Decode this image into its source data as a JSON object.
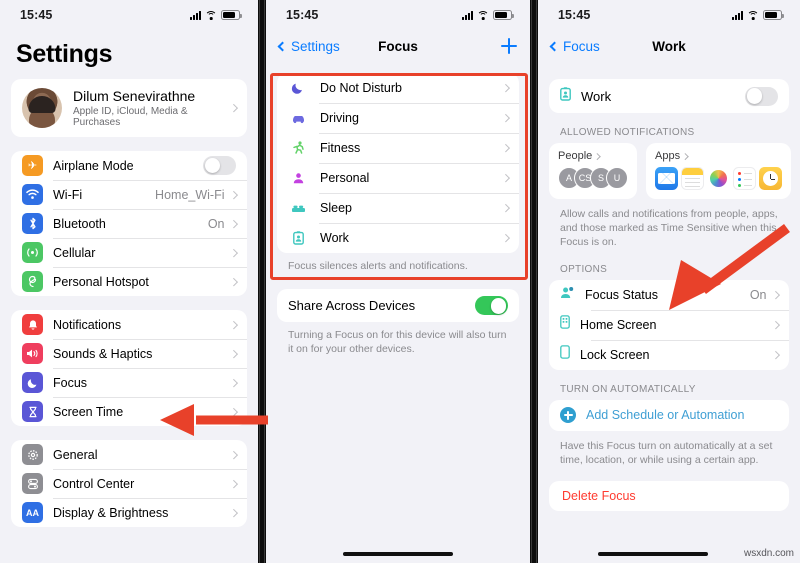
{
  "statusbar": {
    "time": "15:45"
  },
  "panel1": {
    "title": "Settings",
    "profile": {
      "name": "Dilum Senevirathne",
      "subtitle": "Apple ID, iCloud, Media & Purchases"
    },
    "group_connectivity": [
      {
        "label": "Airplane Mode",
        "icon": "airplane-icon",
        "color": "#f59a23",
        "control": "toggle",
        "value": "off"
      },
      {
        "label": "Wi-Fi",
        "icon": "wifi-icon",
        "color": "#2f6fe4",
        "value": "Home_Wi-Fi",
        "control": "chevron"
      },
      {
        "label": "Bluetooth",
        "icon": "bluetooth-icon",
        "color": "#2f6fe4",
        "value": "On",
        "control": "chevron"
      },
      {
        "label": "Cellular",
        "icon": "cellular-icon",
        "color": "#4cc764",
        "value": "",
        "control": "chevron"
      },
      {
        "label": "Personal Hotspot",
        "icon": "hotspot-icon",
        "color": "#4cc764",
        "value": "",
        "control": "chevron"
      }
    ],
    "group_alerts": [
      {
        "label": "Notifications",
        "icon": "bell-icon",
        "color": "#f03e3e"
      },
      {
        "label": "Sounds & Haptics",
        "icon": "speaker-icon",
        "color": "#ef3e5e"
      },
      {
        "label": "Focus",
        "icon": "moon-icon",
        "color": "#5a56d6"
      },
      {
        "label": "Screen Time",
        "icon": "hourglass-icon",
        "color": "#5a56d6"
      }
    ],
    "group_system": [
      {
        "label": "General",
        "icon": "gear-icon",
        "color": "#8e8e93"
      },
      {
        "label": "Control Center",
        "icon": "sliders-icon",
        "color": "#8e8e93"
      },
      {
        "label": "Display & Brightness",
        "icon": "display-icon",
        "color": "#2f6fe4"
      }
    ]
  },
  "panel2": {
    "nav": {
      "back": "Settings",
      "title": "Focus",
      "add": "add-icon"
    },
    "focus_items": [
      {
        "label": "Do Not Disturb",
        "icon": "moon-icon",
        "color": "#5a56d6"
      },
      {
        "label": "Driving",
        "icon": "car-icon",
        "color": "#6d6ae0"
      },
      {
        "label": "Fitness",
        "icon": "running-icon",
        "color": "#63d26a"
      },
      {
        "label": "Personal",
        "icon": "person-icon",
        "color": "#c341e0"
      },
      {
        "label": "Sleep",
        "icon": "bed-icon",
        "color": "#3fc7bf"
      },
      {
        "label": "Work",
        "icon": "badge-icon",
        "color": "#3fc7bf"
      }
    ],
    "focus_footnote": "Focus silences alerts and notifications.",
    "share": {
      "label": "Share Across Devices",
      "value": "on"
    },
    "share_footnote": "Turning a Focus on for this device will also turn it on for your other devices."
  },
  "panel3": {
    "nav": {
      "back": "Focus",
      "title": "Work"
    },
    "header_row": {
      "label": "Work",
      "icon": "badge-icon",
      "value": "off"
    },
    "allowed_header": "ALLOWED NOTIFICATIONS",
    "people": {
      "label": "People",
      "avatars": [
        "A",
        "CS",
        "S",
        "U"
      ]
    },
    "apps": {
      "label": "Apps",
      "icons": [
        "mail-icon",
        "notes-icon",
        "photos-icon",
        "reminders-icon",
        "clock-icon"
      ]
    },
    "allowed_footnote": "Allow calls and notifications from people, apps, and those marked as Time Sensitive when this Focus is on.",
    "options_header": "OPTIONS",
    "options": [
      {
        "label": "Focus Status",
        "icon": "focus-status-icon",
        "value": "On"
      },
      {
        "label": "Home Screen",
        "icon": "home-screen-icon",
        "value": ""
      },
      {
        "label": "Lock Screen",
        "icon": "lock-screen-icon",
        "value": ""
      }
    ],
    "automatic_header": "TURN ON AUTOMATICALLY",
    "add_schedule": "Add Schedule or Automation",
    "automatic_footnote": "Have this Focus turn on automatically at a set time, location, or while using a certain app.",
    "delete": "Delete Focus"
  },
  "annotations": {
    "watermark": "wsxdn.com",
    "highlight_color": "#e8412a",
    "arrow_color": "#e8412a"
  }
}
